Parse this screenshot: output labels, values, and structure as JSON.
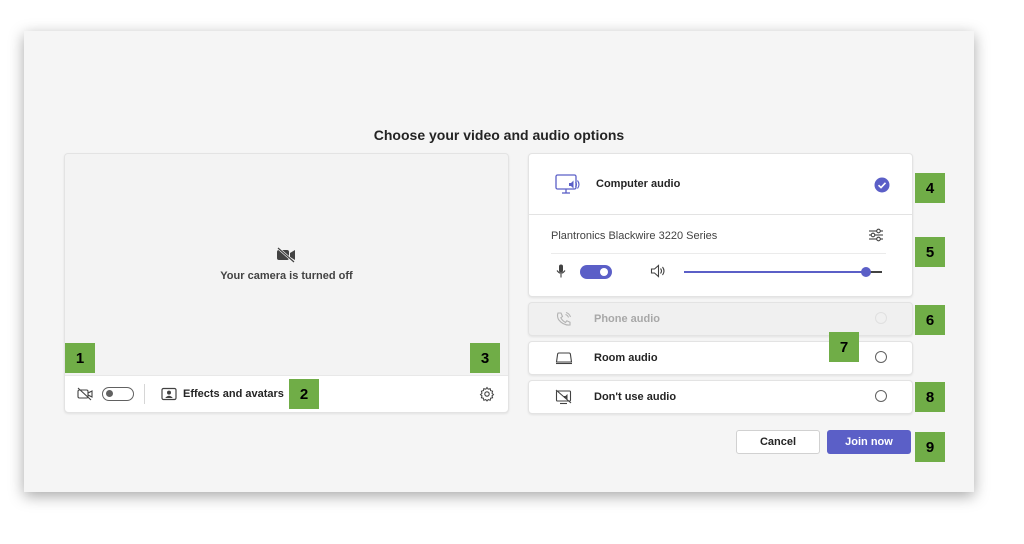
{
  "dialog": {
    "title": "Choose your video and audio options"
  },
  "video": {
    "camera_off_text": "Your camera is turned off",
    "camera_toggle_on": false,
    "effects_label": "Effects and avatars"
  },
  "audio": {
    "computer_label": "Computer audio",
    "computer_selected": true,
    "device_name": "Plantronics Blackwire 3220 Series",
    "mic_toggle_on": true,
    "volume_percent": 93,
    "options": [
      {
        "label": "Phone audio",
        "disabled": true
      },
      {
        "label": "Room audio",
        "disabled": false
      },
      {
        "label": "Don't use audio",
        "disabled": false
      }
    ]
  },
  "actions": {
    "cancel_label": "Cancel",
    "join_label": "Join now"
  },
  "callouts": [
    "1",
    "2",
    "3",
    "4",
    "5",
    "6",
    "7",
    "8",
    "9"
  ],
  "colors": {
    "accent": "#5b5fc7",
    "callout": "#70ad47",
    "background": "#f5f5f5"
  },
  "icons": [
    "camera-off-icon",
    "camera-icon",
    "effects-icon",
    "gear-icon",
    "computer-audio-icon",
    "check-icon",
    "device-settings-icon",
    "microphone-icon",
    "speaker-icon",
    "phone-icon",
    "room-audio-icon",
    "no-audio-icon"
  ]
}
